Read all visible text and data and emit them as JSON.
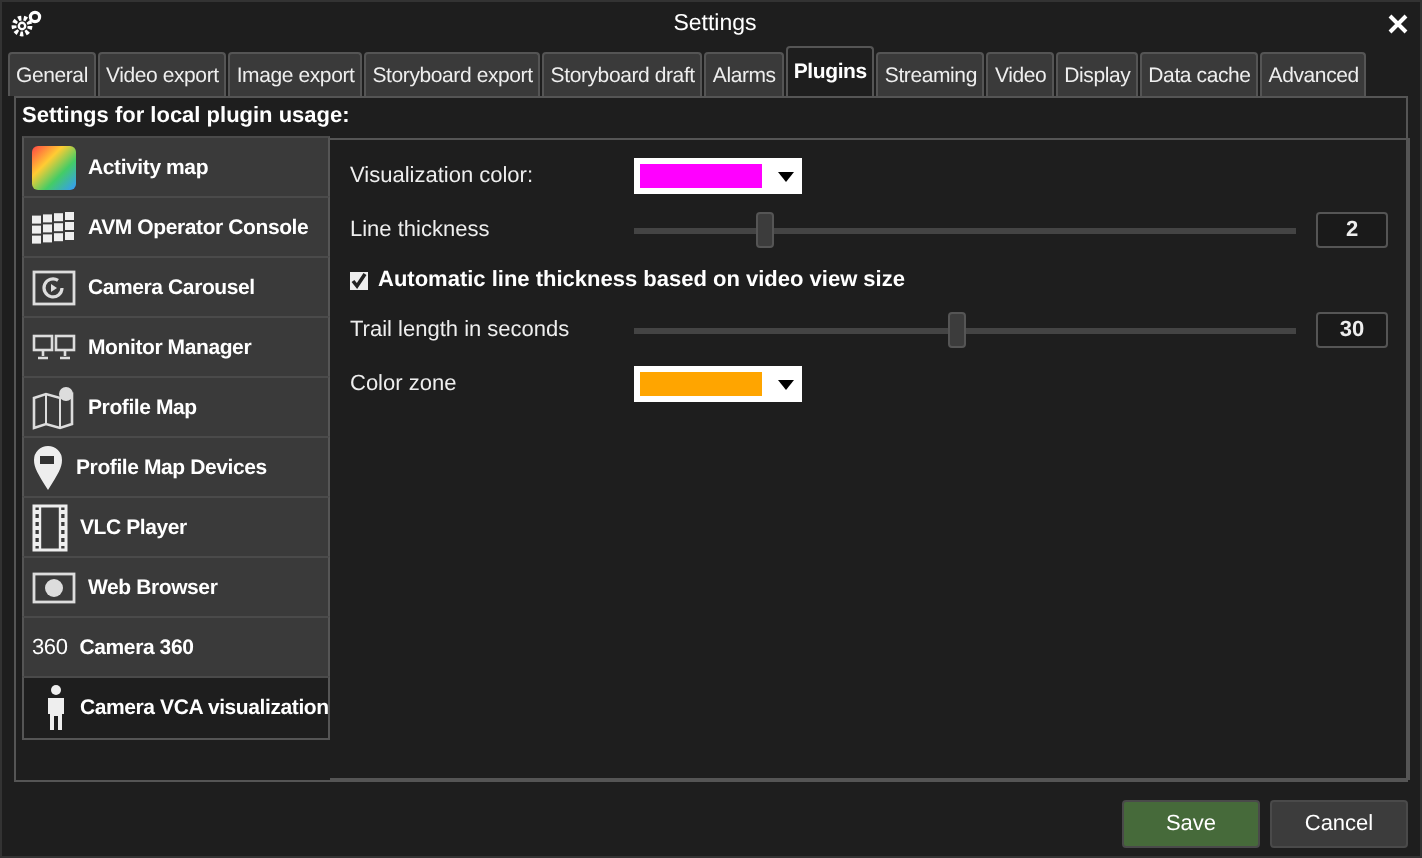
{
  "window": {
    "title": "Settings"
  },
  "tabs": [
    {
      "label": "General",
      "selected": false
    },
    {
      "label": "Video export",
      "selected": false
    },
    {
      "label": "Image export",
      "selected": false
    },
    {
      "label": "Storyboard export",
      "selected": false
    },
    {
      "label": "Storyboard draft",
      "selected": false
    },
    {
      "label": "Alarms",
      "selected": false
    },
    {
      "label": "Plugins",
      "selected": true
    },
    {
      "label": "Streaming",
      "selected": false
    },
    {
      "label": "Video",
      "selected": false
    },
    {
      "label": "Display",
      "selected": false
    },
    {
      "label": "Data cache",
      "selected": false
    },
    {
      "label": "Advanced",
      "selected": false
    }
  ],
  "heading": "Settings for local plugin usage:",
  "plugins": [
    {
      "label": "Activity map",
      "kind": "heatmap",
      "selected": false
    },
    {
      "label": "AVM Operator Console",
      "kind": "grid",
      "selected": false
    },
    {
      "label": "Camera Carousel",
      "kind": "carousel",
      "selected": false
    },
    {
      "label": "Monitor Manager",
      "kind": "monitors",
      "selected": false
    },
    {
      "label": "Profile Map",
      "kind": "map",
      "selected": false
    },
    {
      "label": "Profile Map Devices",
      "kind": "pin",
      "selected": false
    },
    {
      "label": "VLC Player",
      "kind": "film",
      "selected": false
    },
    {
      "label": "Web Browser",
      "kind": "browser",
      "selected": false
    },
    {
      "label": "Camera 360",
      "kind": "text360",
      "icon_text": "360",
      "selected": false
    },
    {
      "label": "Camera VCA visualization",
      "kind": "person",
      "selected": true
    }
  ],
  "settings": [
    {
      "kind": "color",
      "label": "Visualization color:",
      "color": "#ff00ff"
    },
    {
      "kind": "slider",
      "label": "Line thickness",
      "level": 0.2,
      "value": "2"
    },
    {
      "kind": "checkbox",
      "label": "Automatic line thickness based on video view size",
      "checked": true
    },
    {
      "kind": "slider",
      "label": "Trail length in seconds",
      "level": 0.49,
      "value": "30"
    },
    {
      "kind": "color",
      "label": "Color zone",
      "color": "#ffa500"
    }
  ],
  "buttons": [
    {
      "label": "Save",
      "kind": "primary"
    },
    {
      "label": "Cancel",
      "kind": "secondary"
    }
  ]
}
